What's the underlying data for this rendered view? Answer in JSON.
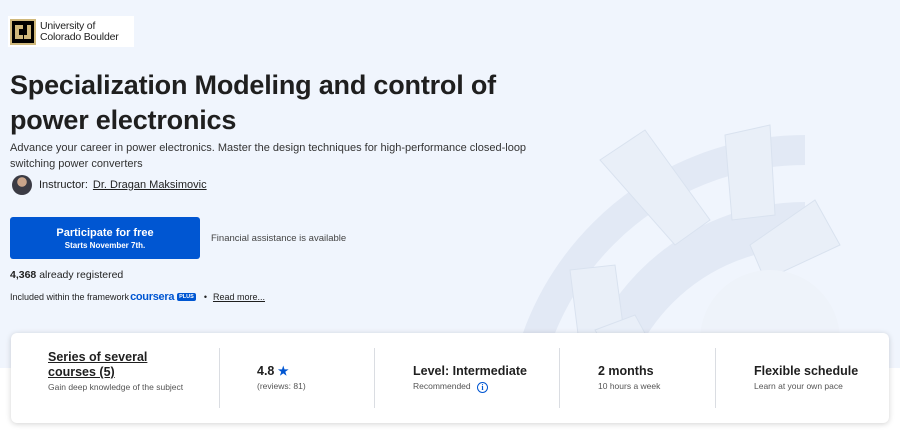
{
  "institution": {
    "name": "University of Colorado Boulder",
    "logo_icon": "cu-boulder-logo"
  },
  "course": {
    "title": "Specialization Modeling and control of power electronics",
    "subtitle": "Advance your career in power electronics. Master the design techniques for high-performance closed-loop switching power converters"
  },
  "instructor": {
    "label": "Instructor:",
    "name": "Dr. Dragan Maksimovic"
  },
  "cta": {
    "main_label": "Participate for free",
    "sub_label": "Starts November 7th.",
    "financial_aid": "Financial assistance is available"
  },
  "registration": {
    "count": "4,368",
    "suffix": "already registered"
  },
  "included": {
    "prefix": "Included within the framework",
    "brand": "coursera",
    "badge": "PLUS",
    "separator": "•",
    "read_more": "Read more..."
  },
  "summary": {
    "series": {
      "title": "Series of several courses (5)",
      "subtitle": "Gain deep knowledge of the subject"
    },
    "rating": {
      "value": "4.8",
      "star": "★",
      "reviews": "(reviews: 81)"
    },
    "level": {
      "title": "Level: Intermediate",
      "subtitle": "Recommended",
      "info_icon": "i"
    },
    "duration": {
      "title": "2 months",
      "subtitle": "10 hours a week"
    },
    "schedule": {
      "title": "Flexible schedule",
      "subtitle": "Learn at your own pace"
    }
  },
  "colors": {
    "accent": "#0056d2",
    "hero_bg": "#f0f5fd",
    "decoration": "#e3eaf6"
  }
}
